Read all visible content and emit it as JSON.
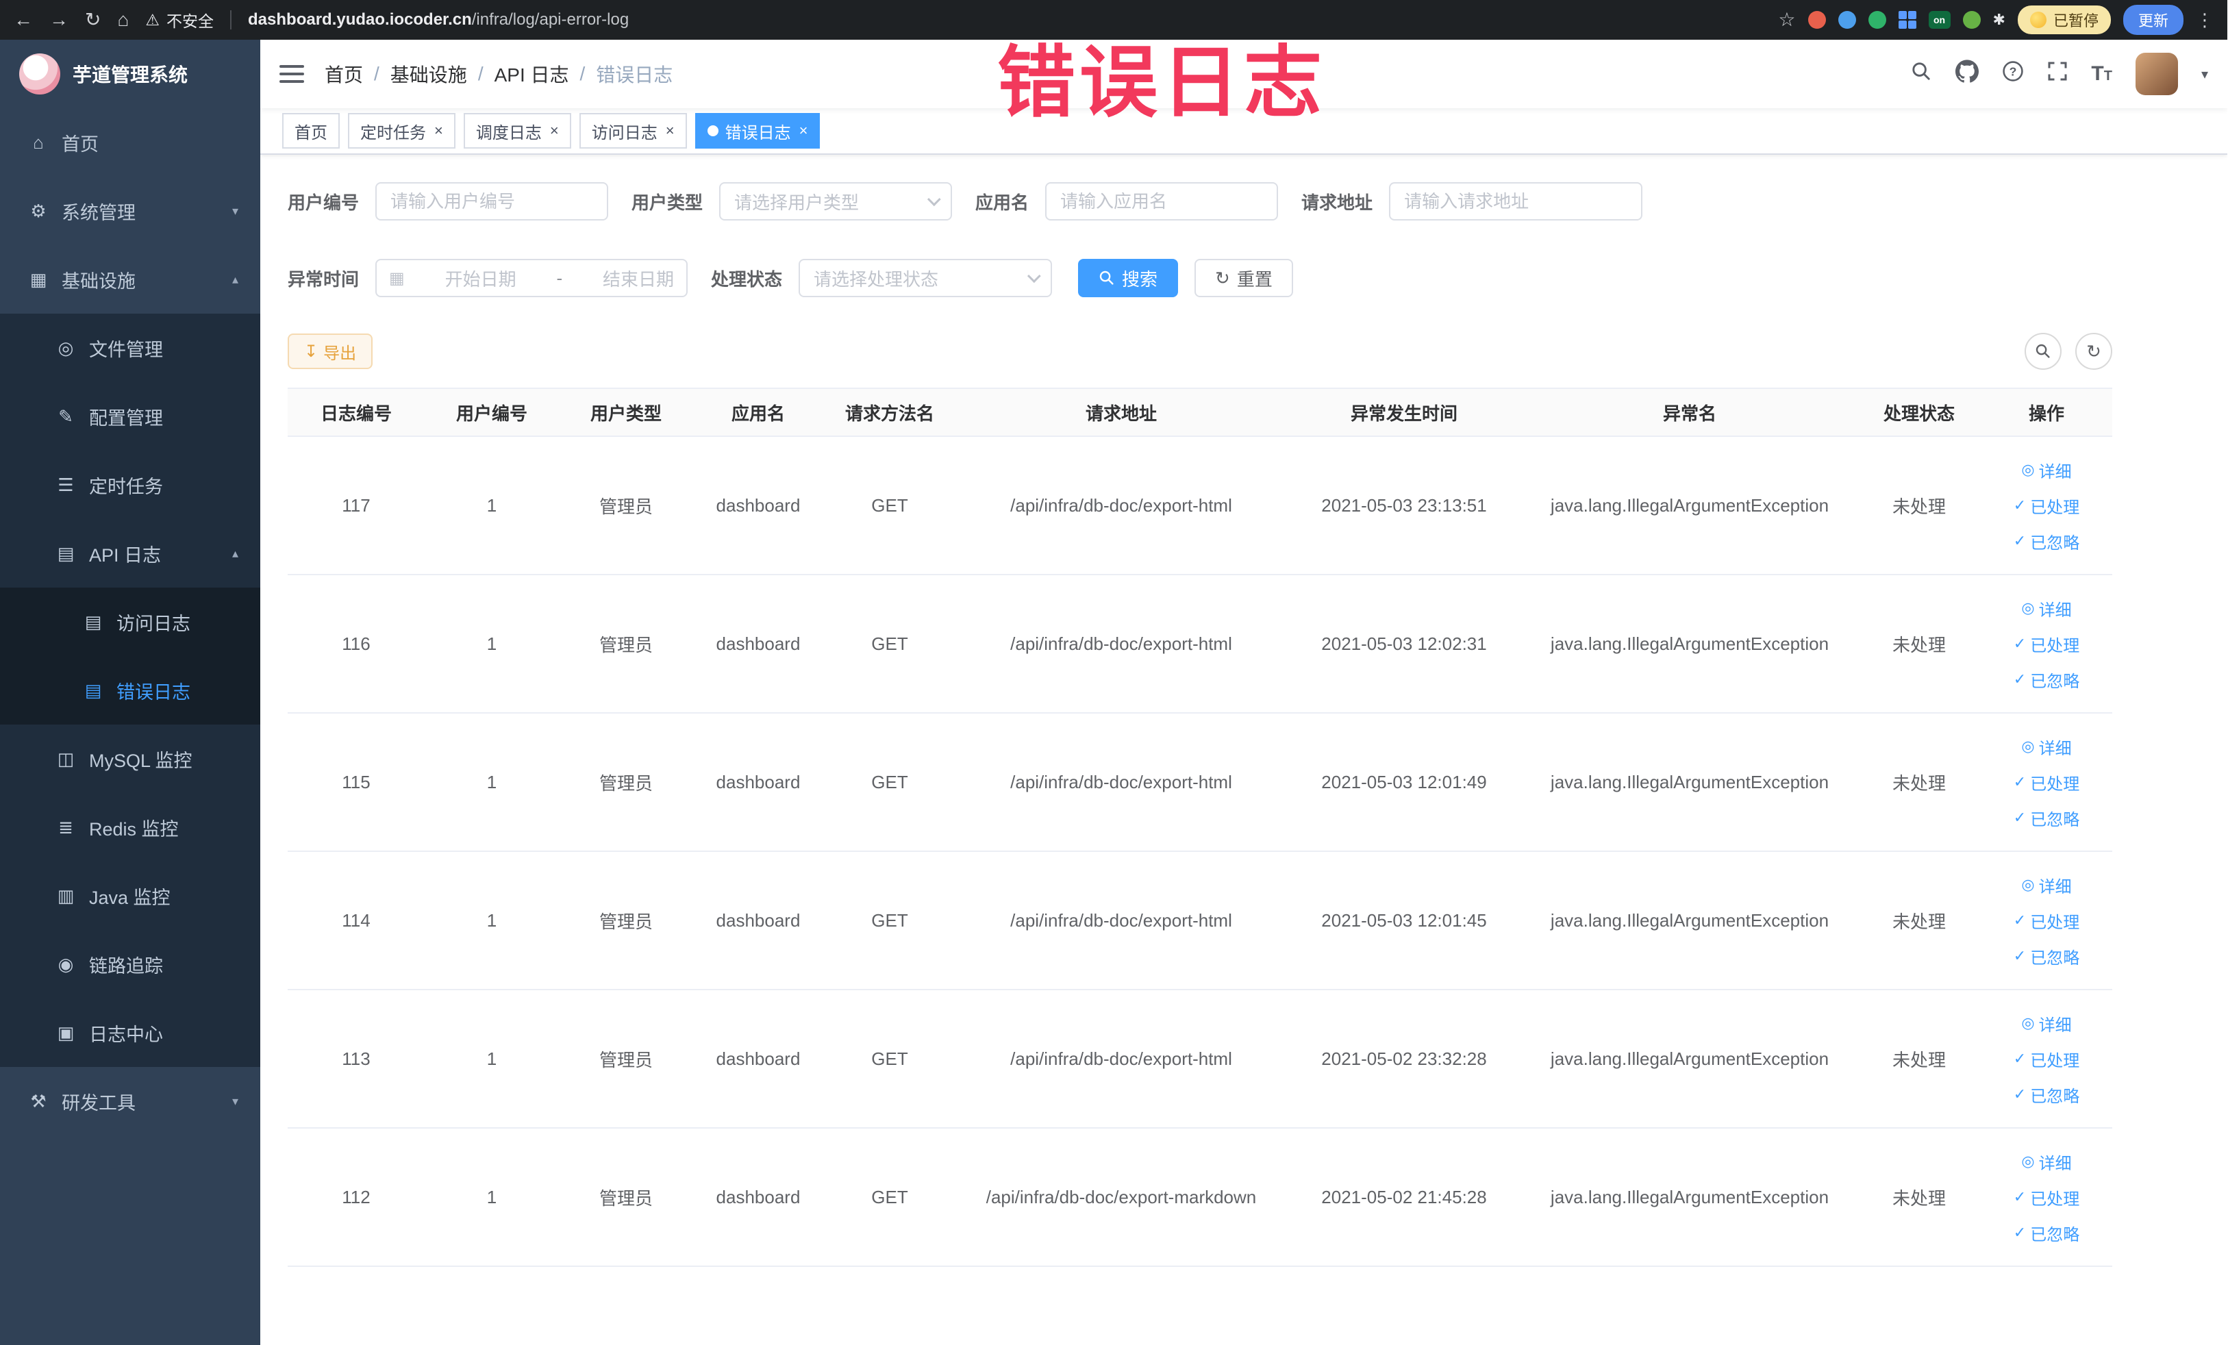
{
  "colors": {
    "accent": "#409eff",
    "annotation": "#f2395c",
    "sidebar_bg": "#304156",
    "active_tab_bg": "#409eff"
  },
  "icons": {
    "back": "←",
    "forward": "→",
    "reload": "↻",
    "home": "⌂",
    "warning": "⚠",
    "star": "☆",
    "ellipsis": "⋮",
    "paw": "✱",
    "menu_home": "⌂",
    "menu_gear": "⚙",
    "menu_grid": "▦",
    "menu_file": "◎",
    "menu_edit": "✎",
    "menu_list": "☰",
    "menu_api": "▤",
    "menu_doc": "▤",
    "menu_db": "◫",
    "menu_redis": "≣",
    "menu_java": "▥",
    "menu_eye": "◉",
    "menu_log": "▣",
    "menu_tools": "⚒",
    "arrow_up": "▴",
    "arrow_down": "▾",
    "close": "×",
    "check": "✓",
    "eye": "◎",
    "download": "↧",
    "refresh": "↻",
    "calendar": "▦"
  },
  "browser": {
    "security_label": "不安全",
    "url_host": "dashboard.yudao.iocoder.cn",
    "url_path": "/infra/log/api-error-log",
    "extension_badge": "on",
    "paused_label": "已暂停",
    "update_label": "更新"
  },
  "annotation": {
    "text": "错误日志"
  },
  "sidebar": {
    "title": "芋道管理系统",
    "items": [
      {
        "label": "首页"
      },
      {
        "label": "系统管理"
      },
      {
        "label": "基础设施"
      },
      {
        "label": "文件管理"
      },
      {
        "label": "配置管理"
      },
      {
        "label": "定时任务"
      },
      {
        "label": "API 日志"
      },
      {
        "label": "访问日志"
      },
      {
        "label": "错误日志"
      },
      {
        "label": "MySQL 监控"
      },
      {
        "label": "Redis 监控"
      },
      {
        "label": "Java 监控"
      },
      {
        "label": "链路追踪"
      },
      {
        "label": "日志中心"
      },
      {
        "label": "研发工具"
      }
    ]
  },
  "header": {
    "breadcrumb": [
      "首页",
      "基础设施",
      "API 日志",
      "错误日志"
    ]
  },
  "tabs": [
    {
      "label": "首页"
    },
    {
      "label": "定时任务"
    },
    {
      "label": "调度日志"
    },
    {
      "label": "访问日志"
    },
    {
      "label": "错误日志"
    }
  ],
  "filters": {
    "user_id_label": "用户编号",
    "user_id_placeholder": "请输入用户编号",
    "user_type_label": "用户类型",
    "user_type_placeholder": "请选择用户类型",
    "app_name_label": "应用名",
    "app_name_placeholder": "请输入应用名",
    "request_url_label": "请求地址",
    "request_url_placeholder": "请输入请求地址",
    "time_label": "异常时间",
    "start_placeholder": "开始日期",
    "end_placeholder": "结束日期",
    "range_separator": "-",
    "status_label": "处理状态",
    "status_placeholder": "请选择处理状态",
    "search_label": "搜索",
    "reset_label": "重置"
  },
  "toolbar": {
    "export_label": "导出"
  },
  "table": {
    "columns": [
      "日志编号",
      "用户编号",
      "用户类型",
      "应用名",
      "请求方法名",
      "请求地址",
      "异常发生时间",
      "异常名",
      "处理状态",
      "操作"
    ],
    "actions": {
      "detail": "详细",
      "resolve": "已处理",
      "ignore": "已忽略"
    },
    "rows": [
      {
        "log_id": "117",
        "user_id": "1",
        "user_type": "管理员",
        "app_name": "dashboard",
        "method": "GET",
        "url": "/api/infra/db-doc/export-html",
        "time": "2021-05-03 23:13:51",
        "exception": "java.lang.IllegalArgumentException",
        "status": "未处理"
      },
      {
        "log_id": "116",
        "user_id": "1",
        "user_type": "管理员",
        "app_name": "dashboard",
        "method": "GET",
        "url": "/api/infra/db-doc/export-html",
        "time": "2021-05-03 12:02:31",
        "exception": "java.lang.IllegalArgumentException",
        "status": "未处理"
      },
      {
        "log_id": "115",
        "user_id": "1",
        "user_type": "管理员",
        "app_name": "dashboard",
        "method": "GET",
        "url": "/api/infra/db-doc/export-html",
        "time": "2021-05-03 12:01:49",
        "exception": "java.lang.IllegalArgumentException",
        "status": "未处理"
      },
      {
        "log_id": "114",
        "user_id": "1",
        "user_type": "管理员",
        "app_name": "dashboard",
        "method": "GET",
        "url": "/api/infra/db-doc/export-html",
        "time": "2021-05-03 12:01:45",
        "exception": "java.lang.IllegalArgumentException",
        "status": "未处理"
      },
      {
        "log_id": "113",
        "user_id": "1",
        "user_type": "管理员",
        "app_name": "dashboard",
        "method": "GET",
        "url": "/api/infra/db-doc/export-html",
        "time": "2021-05-02 23:32:28",
        "exception": "java.lang.IllegalArgumentException",
        "status": "未处理"
      },
      {
        "log_id": "112",
        "user_id": "1",
        "user_type": "管理员",
        "app_name": "dashboard",
        "method": "GET",
        "url": "/api/infra/db-doc/export-markdown",
        "time": "2021-05-02 21:45:28",
        "exception": "java.lang.IllegalArgumentException",
        "status": "未处理"
      }
    ]
  }
}
